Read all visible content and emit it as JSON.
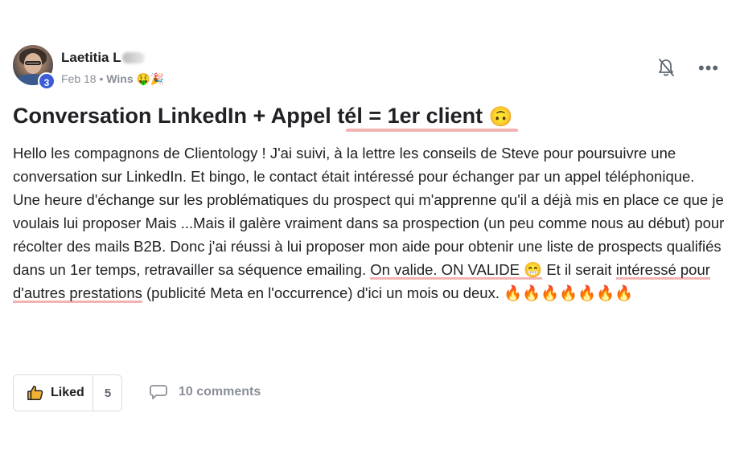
{
  "post": {
    "author": {
      "name": "Laetitia L",
      "level": "3"
    },
    "meta": {
      "date": "Feb 18",
      "separator": "•",
      "category": "Wins",
      "category_emoji": "🤑🎉"
    },
    "title": {
      "text": "Conversation LinkedIn + Appel tél = 1er client",
      "emoji": "🙃"
    },
    "body": {
      "p1": "Hello les compagnons de Clientology ! J'ai suivi, à la lettre les conseils de Steve pour poursuivre une conversation sur LinkedIn. Et bingo, le contact était intéressé pour échanger par un appel téléphonique.",
      "p2_a": "Une heure d'échange sur les problématiques du prospect qui m'apprenne qu'il a déjà mis en place ce que je voulais lui proposer Mais ...Mais il galère vraiment dans sa prospection (un peu comme nous au début) pour récolter des mails B2B. Donc j'ai réussi à lui proposer mon aide pour obtenir une liste de prospects qualifiés dans un 1er temps, retravailler sa séquence emailing. ",
      "p2_hl1": "On valide. ON VALIDE 😁",
      "p2_b": " Et il serait ",
      "p2_hl2": "intéressé pour d'autres prestations",
      "p2_c": " (publicité Meta en l'occurrence) d'ici un mois ou deux. 🔥🔥🔥🔥🔥🔥🔥"
    },
    "actions": {
      "like_label": "Liked",
      "like_count": "5",
      "comments_label": "10 comments"
    },
    "colors": {
      "highlight": "#f4b3b3",
      "badge": "#3b5bdb",
      "muted": "#8a8f98"
    }
  }
}
